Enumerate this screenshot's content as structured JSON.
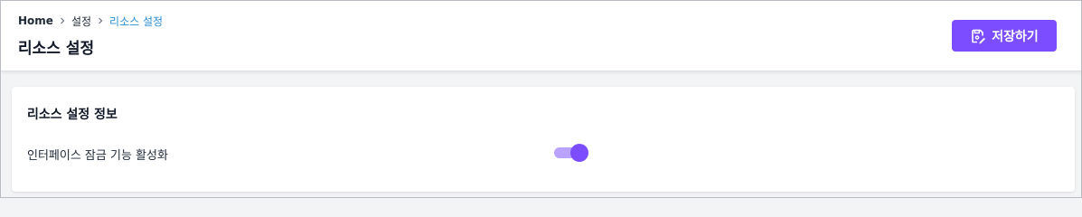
{
  "breadcrumb": {
    "home": "Home",
    "settings": "설정",
    "current": "리소스 설정"
  },
  "page": {
    "title": "리소스 설정"
  },
  "toolbar": {
    "save_label": "저장하기",
    "save_icon": "save-edit-icon"
  },
  "card": {
    "title": "리소스 설정 정보",
    "settings": [
      {
        "label": "인터페이스 잠금 기능 활성화",
        "enabled": true
      }
    ]
  },
  "colors": {
    "accent": "#7c4dff",
    "toggle_track": "#b9a3ff",
    "breadcrumb_active": "#2b8fd6"
  }
}
